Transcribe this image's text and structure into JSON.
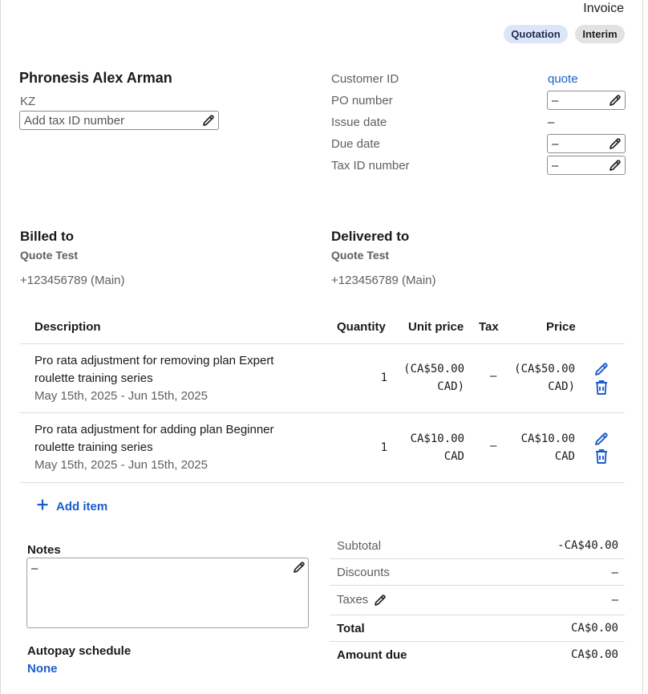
{
  "header": {
    "doc_type": "Invoice",
    "badges": [
      "Quotation",
      "Interim"
    ]
  },
  "seller": {
    "name": "Phronesis Alex Arman",
    "country": "KZ",
    "tax_id_placeholder": "Add tax ID number"
  },
  "meta": {
    "customer_id_label": "Customer ID",
    "customer_id_value": "quote",
    "po_label": "PO number",
    "po_value": "–",
    "issue_label": "Issue date",
    "issue_value": "–",
    "due_label": "Due date",
    "due_value": "–",
    "taxid_label": "Tax ID number",
    "taxid_value": "–"
  },
  "billed": {
    "heading": "Billed to",
    "name": "Quote Test",
    "phone": "+123456789 (Main)"
  },
  "delivered": {
    "heading": "Delivered to",
    "name": "Quote Test",
    "phone": "+123456789 (Main)"
  },
  "table": {
    "headers": {
      "description": "Description",
      "quantity": "Quantity",
      "unit_price": "Unit price",
      "tax": "Tax",
      "price": "Price"
    },
    "rows": [
      {
        "desc_line1": "Pro rata adjustment for removing plan Expert",
        "desc_line2": "roulette training series",
        "period": "May 15th, 2025 - Jun 15th, 2025",
        "quantity": "1",
        "unit_line1": "(CA$50.00",
        "unit_line2": "CAD)",
        "tax": "–",
        "price_line1": "(CA$50.00",
        "price_line2": "CAD)"
      },
      {
        "desc_line1": "Pro rata adjustment for adding plan Beginner",
        "desc_line2": "roulette training series",
        "period": "May 15th, 2025 - Jun 15th, 2025",
        "quantity": "1",
        "unit_line1": "CA$10.00",
        "unit_line2": "CAD",
        "tax": "–",
        "price_line1": "CA$10.00",
        "price_line2": "CAD"
      }
    ],
    "add_item": "Add item"
  },
  "notes": {
    "label": "Notes",
    "value": "–"
  },
  "autopay": {
    "label": "Autopay schedule",
    "value": "None"
  },
  "totals": {
    "subtotal_label": "Subtotal",
    "subtotal_value": "-CA$40.00",
    "discounts_label": "Discounts",
    "discounts_value": "–",
    "taxes_label": "Taxes",
    "taxes_value": "–",
    "total_label": "Total",
    "total_value": "CA$0.00",
    "amount_due_label": "Amount due",
    "amount_due_value": "CA$0.00"
  },
  "colors": {
    "link": "#1a5dc9",
    "quotation_badge_bg": "#dde5fb",
    "interim_badge_bg": "#e2e2e2"
  }
}
